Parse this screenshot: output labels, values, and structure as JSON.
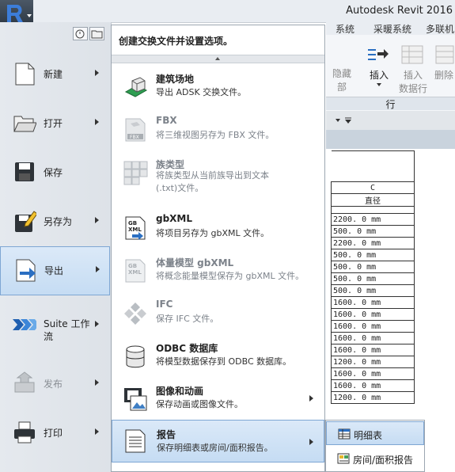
{
  "app": {
    "title": "Autodesk Revit 2016"
  },
  "ribbon": {
    "tabs": [
      "系统",
      "采暖系统",
      "多联机"
    ],
    "buttons": [
      {
        "label_lines": [
          "隐藏",
          "部"
        ]
      },
      {
        "label_lines": [
          "插入"
        ]
      },
      {
        "label_lines": [
          "插入",
          "数据行"
        ]
      },
      {
        "label_lines": [
          "删除"
        ]
      }
    ],
    "group_label": "行"
  },
  "left_menu": {
    "items": [
      {
        "label": "新建",
        "icon": "new-document-icon",
        "has_arrow": true
      },
      {
        "label": "打开",
        "icon": "folder-open-icon",
        "has_arrow": true
      },
      {
        "label": "保存",
        "icon": "floppy-disk-icon",
        "has_arrow": false
      },
      {
        "label": "另存为",
        "icon": "save-as-pencil-icon",
        "has_arrow": true
      },
      {
        "label": "导出",
        "icon": "export-document-icon",
        "has_arrow": true,
        "selected": true
      },
      {
        "label": "Suite 工作\n流",
        "icon": "suite-workflow-chevrons-icon",
        "has_arrow": true
      },
      {
        "label": "发布",
        "icon": "publish-icon",
        "has_arrow": true,
        "disabled": true
      },
      {
        "label": "打印",
        "icon": "printer-icon",
        "has_arrow": true
      }
    ]
  },
  "export_menu": {
    "header": "创建交换文件并设置选项。",
    "items": [
      {
        "title": "建筑场地",
        "desc": "导出 ADSK 交换文件。",
        "icon": "building-site-icon"
      },
      {
        "title": "FBX",
        "desc": "将三维视图另存为 FBX 文件。",
        "icon": "fbx-file-icon",
        "disabled": true
      },
      {
        "title": "族类型",
        "desc": "将族类型从当前族导出到文本(.txt)文件。",
        "icon": "family-types-grid-icon",
        "disabled": true,
        "wrap": true
      },
      {
        "title": "gbXML",
        "desc": "将项目另存为 gbXML 文件。",
        "icon": "gbxml-file-icon"
      },
      {
        "title": "体量模型 gbXML",
        "desc": "将概念能量模型保存为 gbXML 文件。",
        "icon": "mass-gbxml-file-icon",
        "disabled": true
      },
      {
        "title": "IFC",
        "desc": "保存 IFC 文件。",
        "icon": "ifc-logo-icon",
        "disabled": true
      },
      {
        "title": "ODBC 数据库",
        "desc": "将模型数据保存到 ODBC 数据库。",
        "icon": "database-cylinder-icon"
      },
      {
        "title": "图像和动画",
        "desc": "保存动画或图像文件。",
        "icon": "film-image-icon",
        "has_arrow": true
      },
      {
        "title": "报告",
        "desc": "保存明细表或房间/面积报告。",
        "icon": "report-document-icon",
        "has_arrow": true,
        "selected": true
      }
    ]
  },
  "submenu": {
    "items": [
      {
        "label": "明细表",
        "icon": "schedule-table-icon",
        "selected": true
      },
      {
        "label": "房间/面积报告",
        "icon": "room-area-report-icon"
      }
    ]
  },
  "schedule": {
    "column_letter": "C",
    "column_header": "直径",
    "values": [
      "2200. 0  mm",
      "500. 0  mm",
      "2200. 0  mm",
      "500. 0  mm",
      "500. 0  mm",
      "500. 0  mm",
      "500. 0  mm",
      "1600. 0  mm",
      "1600. 0  mm",
      "1600. 0  mm",
      "1600. 0  mm",
      "1600. 0  mm",
      "1200. 0  mm",
      "1600. 0  mm",
      "1600. 0  mm",
      "1200. 0  mm"
    ]
  },
  "colors": {
    "selection_fill": "#c5dcf3",
    "selection_border": "#7ea6d3",
    "export_arrow_blue": "#2b6fc2"
  }
}
